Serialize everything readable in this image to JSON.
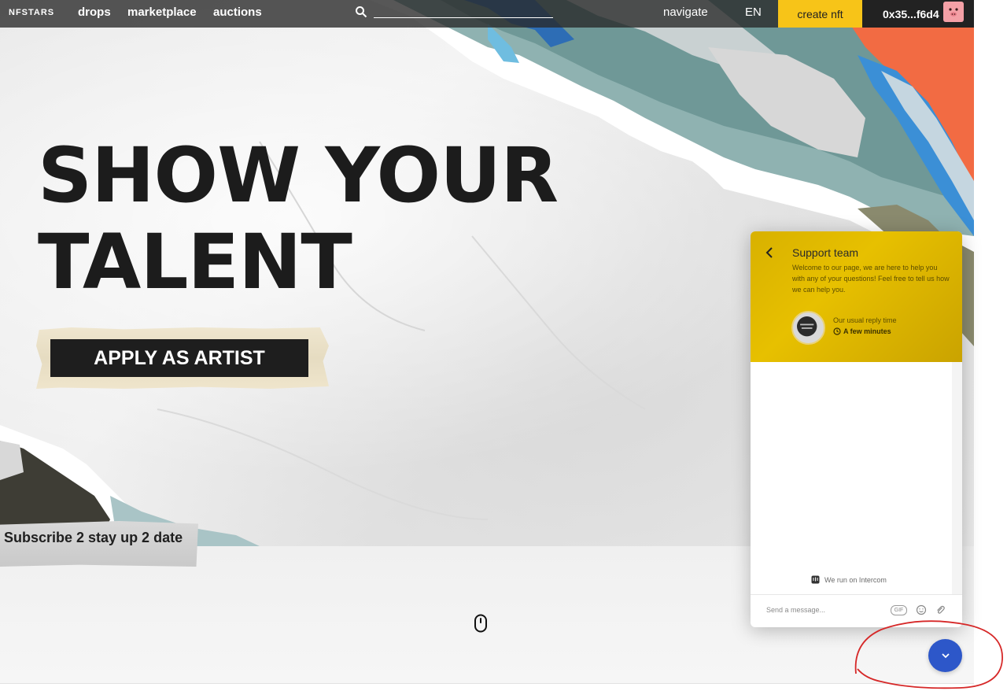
{
  "nav": {
    "logo": "NFSTARS",
    "links": [
      "drops",
      "marketplace",
      "auctions"
    ],
    "search_placeholder": "",
    "navigate": "navigate",
    "language": "EN",
    "create_nft": "create nft",
    "wallet": "0x35...f6d4"
  },
  "hero": {
    "headline_line1": "SHOW YOUR",
    "headline_line2": "TALENT",
    "apply_button": "APPLY AS ARTIST",
    "subscribe": "Subscribe 2 stay up 2 date"
  },
  "messenger": {
    "title": "Support team",
    "intro": "Welcome to our page, we are here to help you with any of your questions! Feel free to tell us how we can help you.",
    "reply_label": "Our usual reply time",
    "reply_time": "A few minutes",
    "powered_by": "We run on Intercom",
    "composer_placeholder": "Send a message...",
    "gif_label": "GIF"
  },
  "colors": {
    "nav_bg": "#282828",
    "create_nft": "#f7c418",
    "wallet_bg": "#222222",
    "messenger_header": "#e0b800",
    "launcher": "#2d57c9",
    "annotation": "#d62828"
  },
  "icons": [
    "search-icon",
    "mouse-scroll-icon",
    "back-chevron-icon",
    "clock-icon",
    "intercom-logo-icon",
    "gif-icon",
    "emoji-icon",
    "attachment-icon",
    "chevron-down-icon"
  ]
}
